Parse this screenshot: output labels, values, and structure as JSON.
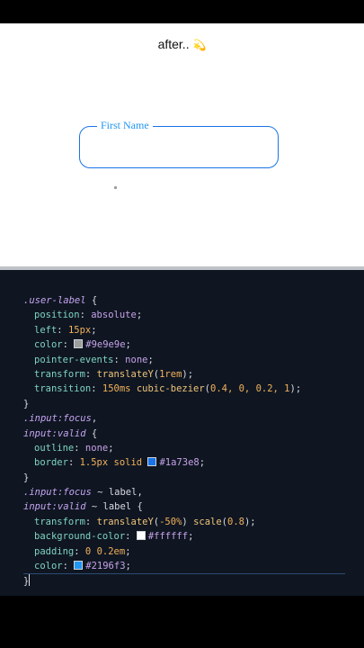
{
  "caption": {
    "text": "after..",
    "emoji": "💫"
  },
  "demo": {
    "label": "First Name"
  },
  "colors": {
    "label_default": "#9e9e9e",
    "border_focus": "#1a73e8",
    "label_bg": "#ffffff",
    "label_focus": "#2196f3"
  },
  "code": {
    "l1_sel": ".user-label",
    "l1_brace": " {",
    "l2_prop": "position",
    "l2_val": "absolute",
    "l3_prop": "left",
    "l3_val": "15px",
    "l4_prop": "color",
    "l4_val": "#9e9e9e",
    "l5_prop": "pointer-events",
    "l5_val": "none",
    "l6_prop": "transform",
    "l6_fn": "translateY",
    "l6_arg": "1rem",
    "l7_prop": "transition",
    "l7_time": "150ms",
    "l7_fn": "cubic-bezier",
    "l7_args": "0.4, 0, 0.2, 1",
    "l8": "}",
    "l9_sel": ".input",
    "l9_pseudo": ":focus",
    "l9_comma": ",",
    "l10_sel": "input",
    "l10_pseudo": ":valid",
    "l10_brace": " {",
    "l11_prop": "outline",
    "l11_val": "none",
    "l12_prop": "border",
    "l12_val": "1.5px solid",
    "l12_color": "#1a73e8",
    "l13": "}",
    "l14_sel": ".input",
    "l14_pseudo": ":focus",
    "l14_rest": " ~ label,",
    "l15_sel": "input",
    "l15_pseudo": ":valid",
    "l15_rest": " ~ label",
    "l15_brace": " {",
    "l16_prop": "transform",
    "l16_fn1": "translateY",
    "l16_arg1": "-50%",
    "l16_fn2": "scale",
    "l16_arg2": "0.8",
    "l17_prop": "background-color",
    "l17_val": "#ffffff",
    "l18_prop": "padding",
    "l18_val": "0 0.2em",
    "l19_prop": "color",
    "l19_val": "#2196f3",
    "l20": "}"
  }
}
